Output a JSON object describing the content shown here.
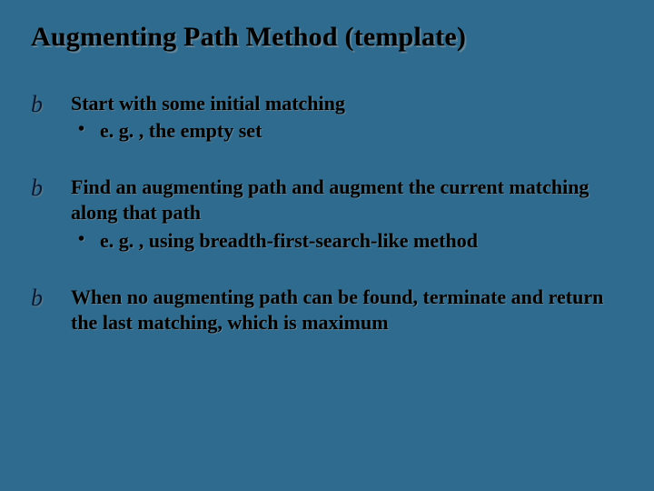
{
  "title": "Augmenting Path Method (template)",
  "items": [
    {
      "bullet": "b",
      "text": "Start with some initial matching",
      "sub": {
        "dot": "•",
        "text": "e. g. , the empty set"
      }
    },
    {
      "bullet": "b",
      "text": "Find an augmenting path and augment the current matching along that path",
      "sub": {
        "dot": "•",
        "text": "e. g. , using breadth-first-search-like method"
      }
    },
    {
      "bullet": "b",
      "text": "When no augmenting path can be found, terminate and return the last matching, which is maximum",
      "sub": null
    }
  ]
}
